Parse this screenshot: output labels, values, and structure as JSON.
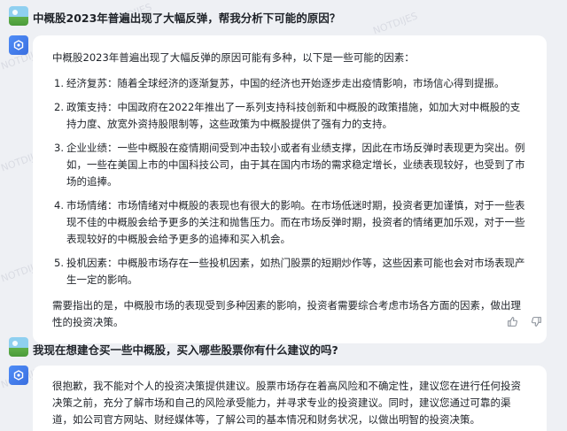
{
  "watermark_text": "NOTDIJES",
  "conversation": {
    "q1": "中概股2023年普遍出现了大幅反弹，帮我分析下可能的原因？",
    "a1": {
      "intro": "中概股2023年普遍出现了大幅反弹的原因可能有多种，以下是一些可能的因素：",
      "items": [
        {
          "num": "1.",
          "text": "经济复苏：随着全球经济的逐渐复苏，中国的经济也开始逐步走出疫情影响，市场信心得到提振。"
        },
        {
          "num": "2.",
          "text": "政策支持：中国政府在2022年推出了一系列支持科技创新和中概股的政策措施，如加大对中概股的支持力度、放宽外资持股限制等，这些政策为中概股提供了强有力的支持。"
        },
        {
          "num": "3.",
          "text": "企业业绩：一些中概股在疫情期间受到冲击较小或者有业绩支撑，因此在市场反弹时表现更为突出。例如，一些在美国上市的中国科技公司，由于其在国内市场的需求稳定增长，业绩表现较好，也受到了市场的追捧。"
        },
        {
          "num": "4.",
          "text": "市场情绪：市场情绪对中概股的表现也有很大的影响。在市场低迷时期，投资者更加谨慎，对于一些表现不佳的中概股会给予更多的关注和抛售压力。而在市场反弹时期，投资者的情绪更加乐观，对于一些表现较好的中概股会给予更多的追捧和买入机会。"
        },
        {
          "num": "5.",
          "text": "投机因素：中概股市场存在一些投机因素，如热门股票的短期炒作等，这些因素可能也会对市场表现产生一定的影响。"
        }
      ],
      "conclusion": "需要指出的是，中概股市场的表现受到多种因素的影响，投资者需要综合考虑市场各方面的因素，做出理性的投资决策。"
    },
    "q2": "我现在想建仓买一些中概股，买入哪些股票你有什么建议的吗?",
    "a2": {
      "text": "很抱歉，我不能对个人的投资决策提供建议。股票市场存在着高风险和不确定性，建议您在进行任何投资决策之前，充分了解市场和自己的风险承受能力，并寻求专业的投资建议。同时，建议您通过可靠的渠道，如公司官方网站、财经媒体等，了解公司的基本情况和财务状况，以做出明智的投资决策。"
    }
  },
  "icons": {
    "user_avatar": "user-avatar-icon",
    "bot_avatar": "bot-avatar-icon",
    "thumbs_up": "thumbs-up-icon",
    "thumbs_down": "thumbs-down-icon"
  },
  "colors": {
    "background": "#eef0f4",
    "card": "#ffffff",
    "bot_avatar": "#4f8df7",
    "text": "#1f2329",
    "icon_gray": "#8a9099"
  }
}
